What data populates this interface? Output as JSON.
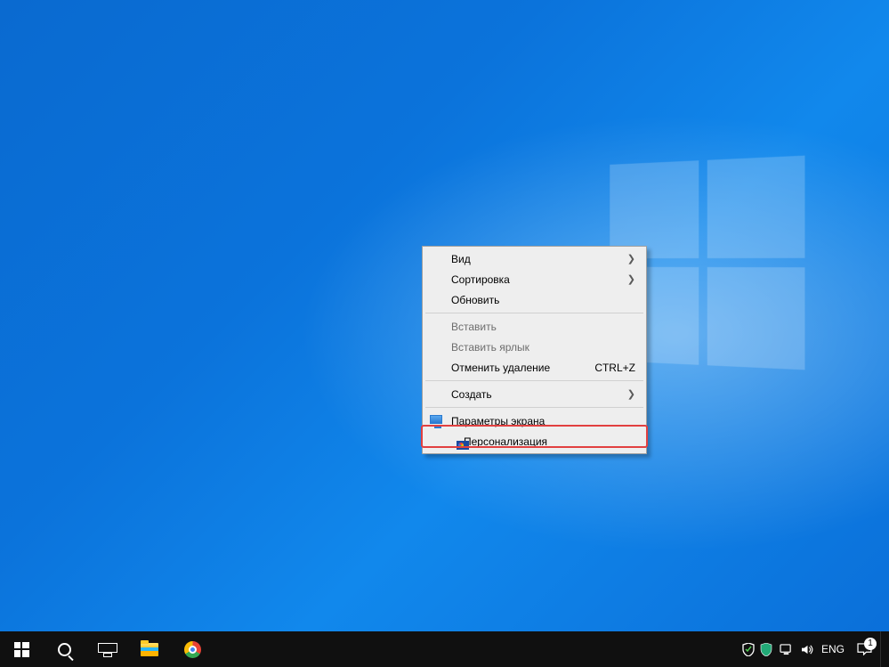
{
  "context_menu": {
    "items": [
      {
        "label": "Вид",
        "has_submenu": true
      },
      {
        "label": "Сортировка",
        "has_submenu": true
      },
      {
        "label": "Обновить"
      },
      {
        "sep": true
      },
      {
        "label": "Вставить",
        "disabled": true
      },
      {
        "label": "Вставить ярлык",
        "disabled": true
      },
      {
        "label": "Отменить удаление",
        "accel": "CTRL+Z"
      },
      {
        "sep": true
      },
      {
        "label": "Создать",
        "has_submenu": true
      },
      {
        "sep": true
      },
      {
        "label": "Параметры экрана",
        "icon": "display"
      },
      {
        "label": "Персонализация",
        "icon": "personalize",
        "highlighted": true
      }
    ]
  },
  "taskbar": {
    "language": "ENG",
    "notification_count": "1"
  }
}
